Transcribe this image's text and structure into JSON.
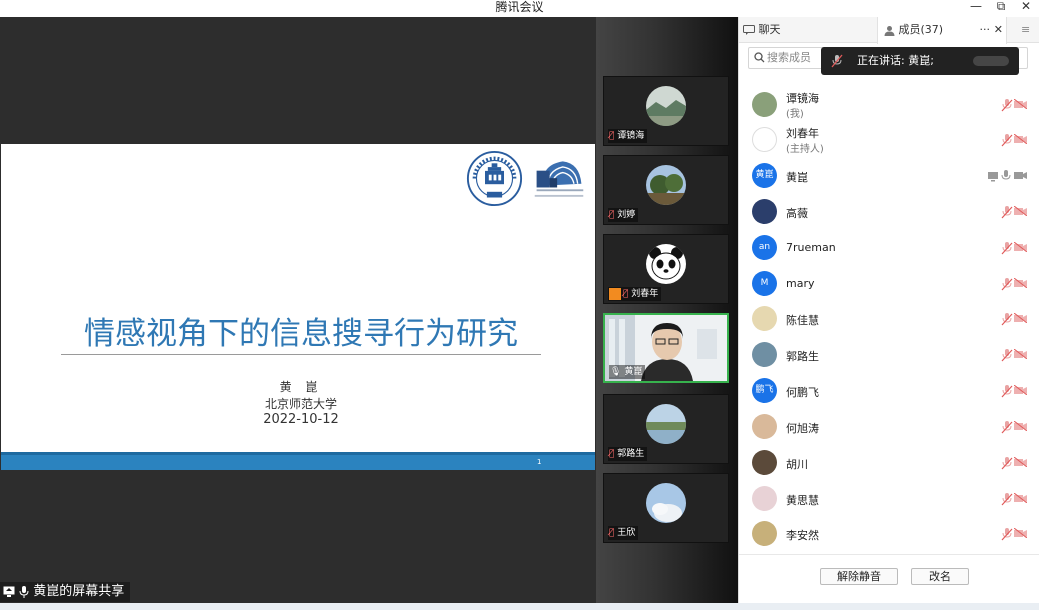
{
  "app": {
    "title": "腾讯会议",
    "window_controls": [
      "—",
      "⧉",
      "✕"
    ]
  },
  "share": {
    "label": "黄崑的屏幕共享",
    "slide": {
      "title": "情感视角下的信息搜寻行为研究",
      "presenter": "黄 崑",
      "organization": "北京师范大学",
      "date": "2022-10-12",
      "page_number": "1",
      "logo_text": "BEIJING NORMAL UNIVERSITY",
      "logo_year": "1902"
    }
  },
  "video_tiles": [
    {
      "name": "谭镜海",
      "mic": "muted",
      "avatar": "landscape"
    },
    {
      "name": "刘婷",
      "mic": "muted",
      "avatar": "trees"
    },
    {
      "name": "刘春年",
      "mic": "muted",
      "avatar": "panda",
      "host": true
    },
    {
      "name": "黄崑",
      "mic": "on",
      "avatar": "camera",
      "active": true
    },
    {
      "name": "郭路生",
      "mic": "muted",
      "avatar": "lake"
    },
    {
      "name": "王欣",
      "mic": "muted",
      "avatar": "sky"
    }
  ],
  "panel": {
    "tab_chat": "聊天",
    "tab_members": "成员(37)",
    "more_label": "···",
    "close_label": "✕",
    "menu_label": "≡",
    "search_placeholder": "搜索成员",
    "speaking_text": "正在讲话: 黄崑;",
    "members": [
      {
        "name": "谭镜海",
        "sub": "(我)",
        "avatar_color": "#8aa07a",
        "avatar_text": ""
      },
      {
        "name": "刘春年",
        "sub": "(主持人)",
        "avatar_color": "#ffffff",
        "avatar_text": ""
      },
      {
        "name": "黄崑",
        "sub": "",
        "avatar_color": "#1a73e8",
        "avatar_text": "黄崑",
        "sharing": true
      },
      {
        "name": "高薇",
        "sub": "",
        "avatar_color": "#2b3e6b",
        "avatar_text": ""
      },
      {
        "name": "7rueman",
        "sub": "",
        "avatar_color": "#1a73e8",
        "avatar_text": "an"
      },
      {
        "name": "mary",
        "sub": "",
        "avatar_color": "#1a73e8",
        "avatar_text": "M"
      },
      {
        "name": "陈佳慧",
        "sub": "",
        "avatar_color": "#e6d8b0",
        "avatar_text": ""
      },
      {
        "name": "郭路生",
        "sub": "",
        "avatar_color": "#6f8fa3",
        "avatar_text": ""
      },
      {
        "name": "何鹏飞",
        "sub": "",
        "avatar_color": "#1a73e8",
        "avatar_text": "鹏飞"
      },
      {
        "name": "何旭涛",
        "sub": "",
        "avatar_color": "#d9b99a",
        "avatar_text": ""
      },
      {
        "name": "胡川",
        "sub": "",
        "avatar_color": "#5b4a3a",
        "avatar_text": ""
      },
      {
        "name": "黄思慧",
        "sub": "",
        "avatar_color": "#e8d2d6",
        "avatar_text": ""
      },
      {
        "name": "李安然",
        "sub": "",
        "avatar_color": "#c7b07a",
        "avatar_text": ""
      }
    ],
    "unmute_all": "解除静音",
    "rename": "改名"
  },
  "colors": {
    "accent": "#1a73e8",
    "muted_icon": "#e05a5a",
    "active_border": "#37b24d",
    "slide_title": "#2f78b4",
    "slide_bar": "#2b83bf"
  }
}
